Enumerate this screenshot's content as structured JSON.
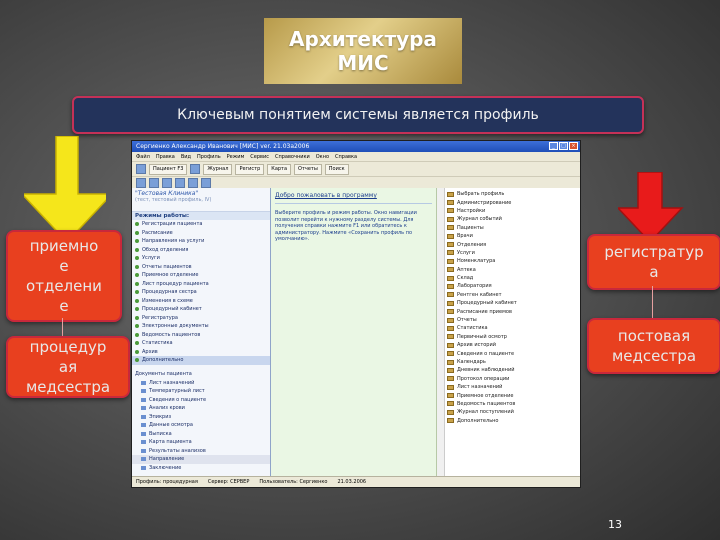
{
  "title": {
    "line1": "Архитектура",
    "line2": "МИС"
  },
  "subtitle": "Ключевым понятием системы является профиль",
  "left_boxes": [
    {
      "text": "приемно\nе\nотделени\nе"
    },
    {
      "text": "процедур\nая\nмедсестра"
    }
  ],
  "right_boxes": [
    {
      "text": "регистратур\nа"
    },
    {
      "text": "постовая\nмедсестра"
    }
  ],
  "page_number": "13",
  "colors": {
    "arrow_left": "#f5e61b",
    "arrow_right": "#e81b1b",
    "box_fill": "#e8401f",
    "subtitle_bg": "#23335b"
  },
  "app": {
    "window_title": "Сергиенко Александр Иванович [МИС] ver. 21.03a2006",
    "menu": [
      "Файл",
      "Правка",
      "Вид",
      "Профиль",
      "Режим",
      "Сервис",
      "Справочники",
      "Окно",
      "Справка"
    ],
    "toolbar_buttons": [
      "Пациент F3",
      "Журнал",
      "Регистр",
      "Карта",
      "Отчеты",
      "Поиск"
    ],
    "clinic_name": "\"Тестовая Клиника\"",
    "clinic_sub": "(тест, тестовый профиль, IV)",
    "modes_header": "Режимы работы:",
    "modes": [
      "Регистрация пациента",
      "Расписание",
      "Направления на услуги",
      "Обход отделения",
      "Услуги",
      "Отчеты пациентов",
      "Приемное отделение",
      "Лист процедур пациента",
      "Процедурная сестра",
      "Изменения в схеме",
      "Процедурный кабинет",
      "Регистратура",
      "Электронные документы",
      "Ведомость пациентов",
      "Статистика",
      "Архив",
      "Дополнительно"
    ],
    "tree_header": "Документы пациента",
    "tree_items": [
      "Лист назначений",
      "Температурный лист",
      "Сведения о пациенте",
      "Анализ крови",
      "Эпикриз",
      "Данные осмотра",
      "Выписка",
      "Карта пациента",
      "Результаты анализов",
      "Направление",
      "Заключение"
    ],
    "center_title": "Добро пожаловать в программу",
    "center_text": "Выберите профиль и режим работы. Окно навигации позволит перейти к нужному разделу системы. Для получения справки нажмите F1 или обратитесь к администратору. Нажмите «Сохранить профиль по умолчанию».",
    "right_items": [
      "Выбрать профиль",
      "Администрирование",
      "Настройки",
      "Журнал событий",
      "Пациенты",
      "Врачи",
      "Отделения",
      "Услуги",
      "Номенклатура",
      "Аптека",
      "Склад",
      "Лаборатория",
      "Рентген кабинет",
      "Процедурный кабинет",
      "Расписание приемов",
      "Отчеты",
      "Статистика",
      "Первичный осмотр",
      "Архив историй",
      "Сведения о пациенте",
      "Календарь",
      "Дневник наблюдений",
      "Протокол операции",
      "Лист назначений",
      "Приемное отделение",
      "Ведомость пациентов",
      "Журнал поступлений",
      "Дополнительно"
    ],
    "status_items": [
      "Профиль: процедурная",
      "Сервер: СЕРВЕР",
      "Пользователь: Сергиенко",
      "21.03.2006"
    ]
  }
}
